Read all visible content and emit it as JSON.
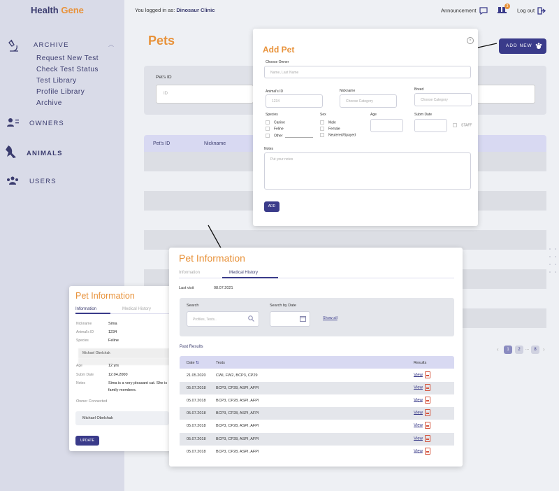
{
  "header": {
    "brand_health": "Health",
    "brand_gene": "Gene",
    "logged_prefix": "You logged in as:",
    "logged_user": "Dinosaur Clinic",
    "announcement": "Announcement",
    "cart_badge": "3",
    "logout": "Log out"
  },
  "sidebar": {
    "archive": {
      "label": "ARCHIVE",
      "items": [
        "Request New Test",
        "Check Test Status",
        "Test Library",
        "Profile Library",
        "Archive"
      ]
    },
    "owners": "OWNERS",
    "animals": "ANIMALS",
    "users": "USERS"
  },
  "main": {
    "title": "Pets",
    "add_new": "ADD NEW",
    "filter_label": "Pet's ID",
    "filter_value": "ID",
    "columns": [
      "Pet's ID",
      "Nickname"
    ]
  },
  "add_pet": {
    "title": "Add Pet",
    "owner_label": "Choose Owner",
    "owner_placeholder": "Name, Last Name",
    "animal_id_label": "Animal's ID",
    "animal_id_placeholder": "1234",
    "nickname_label": "Nickname",
    "nickname_placeholder": "Choose Category",
    "breed_label": "Breed",
    "breed_placeholder": "Choose Category",
    "species_label": "Species",
    "species": [
      "Canine",
      "Feline",
      "Other"
    ],
    "sex_label": "Sex",
    "sex": [
      "Male",
      "Female",
      "Neutered/Spayed"
    ],
    "age_label": "Age",
    "subm_label": "Subm Date",
    "staff": "STAFF",
    "notes_label": "Notes",
    "notes_placeholder": "Put your notes",
    "add_button": "ADD"
  },
  "pet_info_small": {
    "title": "Pet Information",
    "tab_info": "Information",
    "tab_medical": "Medical History",
    "fields": [
      {
        "k": "Nickname",
        "v": "Sima"
      },
      {
        "k": "Animal's ID",
        "v": "1234"
      },
      {
        "k": "Species",
        "v": "Feline"
      }
    ],
    "owner_partial": "Michael Obelchak",
    "fields2": [
      {
        "k": "Age",
        "v": "12 yrs"
      },
      {
        "k": "Subm Date",
        "v": "12.04.2000"
      },
      {
        "k": "Notes",
        "v": "Sima is a very pleasant cat. She is e"
      }
    ],
    "notes_cont": "family members.",
    "owner_connected": "Owner Connected",
    "owner_name": "Michael Obelchak",
    "update_button": "UPDATE"
  },
  "pet_info_large": {
    "title": "Pet Information",
    "tab_info": "Information",
    "tab_medical": "Medical History",
    "last_visit_label": "Last visit",
    "last_visit": "08.07.2021",
    "search_label": "Search",
    "search_placeholder": "Profiles, Tests..",
    "search_date_label": "Search by Date",
    "show_all": "Show all",
    "past_results": "Past Results",
    "col_date": "Date",
    "col_tests": "Tests",
    "col_results": "Results",
    "view_label": "View",
    "results": [
      {
        "date": "21.05.2020",
        "tests": "CWI, FW2, BCP3, CP29"
      },
      {
        "date": "05.07.2018",
        "tests": "BCP3, CP28, ASPI, AFPI"
      },
      {
        "date": "05.07.2018",
        "tests": "BCP3, CP28, ASPI, AFPI"
      },
      {
        "date": "05.07.2018",
        "tests": "BCP3, CP28, ASPI, AFPI"
      },
      {
        "date": "05.07.2018",
        "tests": "BCP3, CP28, ASPI, AFPI"
      },
      {
        "date": "05.07.2018",
        "tests": "BCP3, CP28, ASPI, AFPI"
      },
      {
        "date": "05.07.2018",
        "tests": "BCP3, CP28, ASPI, AFPI"
      }
    ]
  },
  "pagination": [
    "1",
    "2",
    "...",
    "8"
  ],
  "colors": {
    "accent": "#e8923a",
    "primary": "#3a3b8a",
    "sidebar": "#d9dbe8"
  }
}
